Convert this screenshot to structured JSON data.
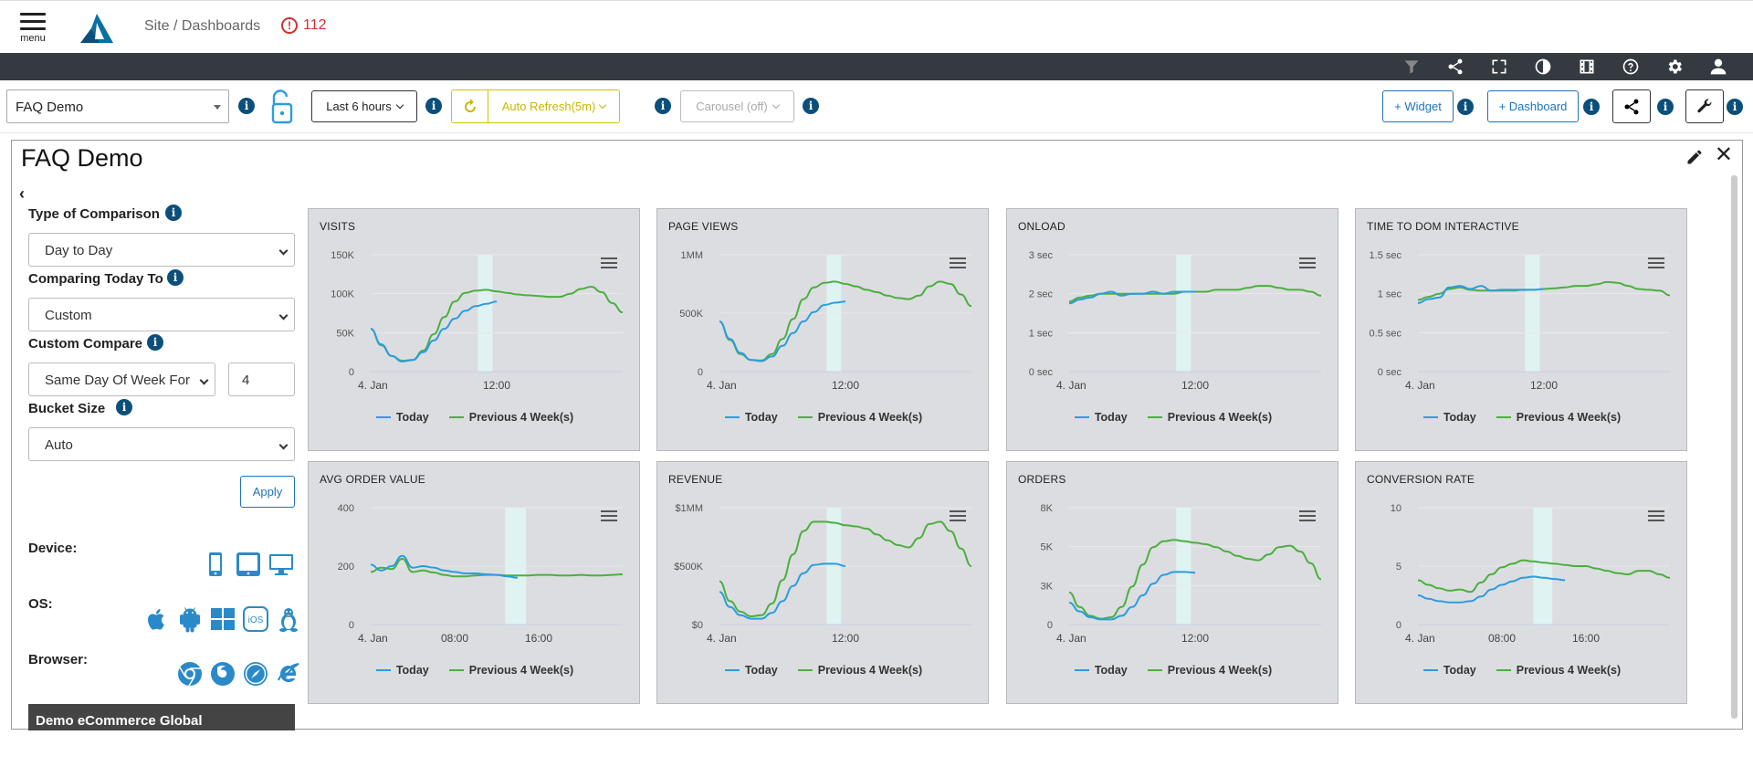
{
  "header": {
    "menu_label": "menu",
    "breadcrumb": "Site / Dashboards",
    "alert_count": "112"
  },
  "toolbar": {
    "dashboard_select": "FAQ Demo",
    "time_range": "Last 6 hours",
    "auto_refresh": "Auto Refresh(5m)",
    "carousel": "Carousel (off)",
    "add_widget": "+ Widget",
    "add_dashboard": "+ Dashboard"
  },
  "panel": {
    "title": "FAQ Demo"
  },
  "sidebar": {
    "type_label": "Type of Comparison",
    "type_value": "Day to Day",
    "comparing_label": "Comparing Today To",
    "comparing_value": "Custom",
    "custom_label": "Custom Compare",
    "custom_value": "Same Day Of Week For",
    "custom_weeks": "4",
    "bucket_label": "Bucket Size",
    "bucket_value": "Auto",
    "apply_label": "Apply",
    "device_label": "Device:",
    "os_label": "OS:",
    "browser_label": "Browser:",
    "footer_text": "Demo eCommerce Global",
    "devices": [
      "phone-icon",
      "tablet-icon",
      "desktop-icon"
    ],
    "os": [
      "apple-icon",
      "android-icon",
      "windows-icon",
      "ios-icon",
      "linux-icon"
    ],
    "browsers": [
      "chrome-icon",
      "firefox-icon",
      "safari-icon",
      "ie-icon"
    ]
  },
  "legend": {
    "today": "Today",
    "previous": "Previous 4 Week(s)"
  },
  "colors": {
    "today": "#2a9de0",
    "previous": "#4caf3f",
    "highlight": "#dff3f3",
    "accent": "#1e73be"
  },
  "chart_data": [
    {
      "type": "line",
      "title": "VISITS",
      "yticks": [
        "150K",
        "100K",
        "50K",
        "0"
      ],
      "ylim": [
        0,
        150000
      ],
      "xticks": [
        {
          "label": "4. Jan",
          "x": 0
        },
        {
          "label": "12:00",
          "x": 12
        }
      ],
      "xlim": [
        0,
        24
      ],
      "band": [
        10.2,
        11.6
      ],
      "series": [
        {
          "name": "Today",
          "x": [
            0,
            1,
            2,
            3,
            4,
            5,
            6,
            7,
            8,
            9,
            10,
            11,
            12
          ],
          "y": [
            55000,
            35000,
            20000,
            13000,
            15000,
            25000,
            40000,
            55000,
            68000,
            78000,
            84000,
            87000,
            90000
          ]
        },
        {
          "name": "Previous 4 Week(s)",
          "x": [
            0,
            1,
            2,
            3,
            4,
            5,
            6,
            7,
            8,
            9,
            10,
            11,
            12,
            13,
            14,
            15,
            16,
            17,
            18,
            19,
            20,
            21,
            22,
            23,
            24
          ],
          "y": [
            55000,
            34000,
            20000,
            14000,
            15000,
            27000,
            48000,
            70000,
            90000,
            101000,
            104000,
            105000,
            103000,
            101000,
            99000,
            98000,
            97000,
            96000,
            96000,
            100000,
            106000,
            109000,
            102000,
            88000,
            76000
          ]
        }
      ]
    },
    {
      "type": "line",
      "title": "PAGE VIEWS",
      "yticks": [
        "1MM",
        "500K",
        "0"
      ],
      "ylim": [
        0,
        1000000
      ],
      "xticks": [
        {
          "label": "4. Jan",
          "x": 0
        },
        {
          "label": "12:00",
          "x": 12
        }
      ],
      "xlim": [
        0,
        24
      ],
      "band": [
        10.2,
        11.6
      ],
      "series": [
        {
          "name": "Today",
          "x": [
            0,
            1,
            2,
            3,
            4,
            5,
            6,
            7,
            8,
            9,
            10,
            11,
            12
          ],
          "y": [
            430000,
            280000,
            160000,
            100000,
            90000,
            130000,
            220000,
            330000,
            430000,
            510000,
            570000,
            590000,
            600000
          ]
        },
        {
          "name": "Previous 4 Week(s)",
          "x": [
            0,
            1,
            2,
            3,
            4,
            5,
            6,
            7,
            8,
            9,
            10,
            11,
            12,
            13,
            14,
            15,
            16,
            17,
            18,
            19,
            20,
            21,
            22,
            23,
            24
          ],
          "y": [
            430000,
            270000,
            150000,
            100000,
            95000,
            150000,
            280000,
            450000,
            620000,
            720000,
            760000,
            770000,
            750000,
            730000,
            700000,
            680000,
            650000,
            630000,
            620000,
            650000,
            730000,
            770000,
            750000,
            660000,
            560000
          ]
        }
      ]
    },
    {
      "type": "line",
      "title": "ONLOAD",
      "yticks": [
        "3 sec",
        "2 sec",
        "1 sec",
        "0 sec"
      ],
      "ylim": [
        0,
        3
      ],
      "xticks": [
        {
          "label": "4. Jan",
          "x": 0
        },
        {
          "label": "12:00",
          "x": 12
        }
      ],
      "xlim": [
        0,
        24
      ],
      "band": [
        10.2,
        11.6
      ],
      "series": [
        {
          "name": "Today",
          "x": [
            0,
            1,
            2,
            3,
            4,
            5,
            6,
            7,
            8,
            9,
            10,
            11,
            12
          ],
          "y": [
            1.75,
            1.85,
            1.9,
            2.0,
            2.05,
            1.95,
            2.0,
            2.0,
            2.05,
            2.0,
            2.05,
            2.05,
            2.05
          ]
        },
        {
          "name": "Previous 4 Week(s)",
          "x": [
            0,
            1,
            2,
            3,
            4,
            5,
            6,
            7,
            8,
            9,
            10,
            11,
            12,
            13,
            14,
            15,
            16,
            17,
            18,
            19,
            20,
            21,
            22,
            23,
            24
          ],
          "y": [
            1.8,
            1.9,
            1.95,
            2.0,
            2.0,
            2.0,
            2.0,
            2.0,
            2.0,
            2.0,
            2.0,
            2.05,
            2.05,
            2.05,
            2.1,
            2.1,
            2.1,
            2.15,
            2.2,
            2.2,
            2.15,
            2.1,
            2.1,
            2.05,
            1.95
          ]
        }
      ]
    },
    {
      "type": "line",
      "title": "TIME TO DOM INTERACTIVE",
      "yticks": [
        "1.5 sec",
        "1 sec",
        "0.5 sec",
        "0 sec"
      ],
      "ylim": [
        0,
        1.5
      ],
      "xticks": [
        {
          "label": "4. Jan",
          "x": 0
        },
        {
          "label": "12:00",
          "x": 12
        }
      ],
      "xlim": [
        0,
        24
      ],
      "band": [
        10.2,
        11.6
      ],
      "series": [
        {
          "name": "Today",
          "x": [
            0,
            1,
            2,
            3,
            4,
            5,
            6,
            7,
            8,
            9,
            10,
            11,
            12
          ],
          "y": [
            0.88,
            0.93,
            0.95,
            1.08,
            1.1,
            1.06,
            1.1,
            1.04,
            1.05,
            1.05,
            1.05,
            1.05,
            1.06
          ]
        },
        {
          "name": "Previous 4 Week(s)",
          "x": [
            0,
            1,
            2,
            3,
            4,
            5,
            6,
            7,
            8,
            9,
            10,
            11,
            12,
            13,
            14,
            15,
            16,
            17,
            18,
            19,
            20,
            21,
            22,
            23,
            24
          ],
          "y": [
            0.92,
            0.96,
            1.0,
            1.06,
            1.08,
            1.05,
            1.04,
            1.04,
            1.04,
            1.04,
            1.05,
            1.05,
            1.06,
            1.07,
            1.08,
            1.1,
            1.1,
            1.12,
            1.15,
            1.14,
            1.1,
            1.06,
            1.05,
            1.04,
            0.98
          ]
        }
      ]
    },
    {
      "type": "line",
      "title": "AVG ORDER VALUE",
      "yticks": [
        "400",
        "200",
        "0"
      ],
      "ylim": [
        0,
        400
      ],
      "xticks": [
        {
          "label": "4. Jan",
          "x": 0
        },
        {
          "label": "08:00",
          "x": 8
        },
        {
          "label": "16:00",
          "x": 16
        }
      ],
      "xlim": [
        0,
        24
      ],
      "band": [
        12.8,
        14.8
      ],
      "series": [
        {
          "name": "Today",
          "x": [
            0,
            1,
            2,
            3,
            4,
            5,
            6,
            7,
            8,
            9,
            10,
            11,
            12,
            13,
            14
          ],
          "y": [
            205,
            185,
            200,
            235,
            195,
            200,
            195,
            185,
            180,
            175,
            175,
            172,
            170,
            165,
            160
          ]
        },
        {
          "name": "Previous 4 Week(s)",
          "x": [
            0,
            1,
            2,
            3,
            4,
            5,
            6,
            7,
            8,
            9,
            10,
            11,
            12,
            13,
            14,
            15,
            16,
            17,
            18,
            19,
            20,
            21,
            22,
            23,
            24
          ],
          "y": [
            180,
            195,
            190,
            225,
            180,
            185,
            178,
            170,
            165,
            165,
            168,
            170,
            170,
            168,
            168,
            168,
            170,
            170,
            168,
            168,
            170,
            168,
            168,
            170,
            172
          ]
        }
      ]
    },
    {
      "type": "line",
      "title": "REVENUE",
      "yticks": [
        "$1MM",
        "$500K",
        "$0"
      ],
      "ylim": [
        0,
        1000000
      ],
      "xticks": [
        {
          "label": "4. Jan",
          "x": 0
        },
        {
          "label": "12:00",
          "x": 12
        }
      ],
      "xlim": [
        0,
        24
      ],
      "band": [
        10.2,
        11.6
      ],
      "series": [
        {
          "name": "Today",
          "x": [
            0,
            1,
            2,
            3,
            4,
            5,
            6,
            7,
            8,
            9,
            10,
            11,
            12
          ],
          "y": [
            280000,
            150000,
            80000,
            50000,
            50000,
            100000,
            200000,
            330000,
            440000,
            510000,
            520000,
            520000,
            500000
          ]
        },
        {
          "name": "Previous 4 Week(s)",
          "x": [
            0,
            1,
            2,
            3,
            4,
            5,
            6,
            7,
            8,
            9,
            10,
            11,
            12,
            13,
            14,
            15,
            16,
            17,
            18,
            19,
            20,
            21,
            22,
            23,
            24
          ],
          "y": [
            370000,
            200000,
            110000,
            70000,
            80000,
            180000,
            380000,
            600000,
            800000,
            880000,
            880000,
            870000,
            850000,
            840000,
            820000,
            770000,
            720000,
            680000,
            660000,
            740000,
            860000,
            880000,
            800000,
            650000,
            500000
          ]
        }
      ]
    },
    {
      "type": "line",
      "title": "ORDERS",
      "yticks": [
        "8K",
        "5K",
        "3K",
        "0"
      ],
      "ylim": [
        0,
        8000
      ],
      "xticks": [
        {
          "label": "4. Jan",
          "x": 0
        },
        {
          "label": "12:00",
          "x": 12
        }
      ],
      "xlim": [
        0,
        24
      ],
      "band": [
        10.2,
        11.6
      ],
      "series": [
        {
          "name": "Today",
          "x": [
            0,
            1,
            2,
            3,
            4,
            5,
            6,
            7,
            8,
            9,
            10,
            11,
            12
          ],
          "y": [
            1500,
            900,
            500,
            350,
            350,
            600,
            1200,
            2000,
            2800,
            3400,
            3600,
            3600,
            3550
          ]
        },
        {
          "name": "Previous 4 Week(s)",
          "x": [
            0,
            1,
            2,
            3,
            4,
            5,
            6,
            7,
            8,
            9,
            10,
            11,
            12,
            13,
            14,
            15,
            16,
            17,
            18,
            19,
            20,
            21,
            22,
            23,
            24
          ],
          "y": [
            2200,
            1200,
            600,
            400,
            500,
            1200,
            2600,
            4100,
            5300,
            5700,
            5800,
            5700,
            5600,
            5500,
            5300,
            5000,
            4700,
            4500,
            4400,
            4800,
            5300,
            5400,
            5000,
            4200,
            3100
          ]
        }
      ]
    },
    {
      "type": "line",
      "title": "CONVERSION RATE",
      "yticks": [
        "10",
        "5",
        "0"
      ],
      "ylim": [
        0,
        10
      ],
      "xticks": [
        {
          "label": "4. Jan",
          "x": 0
        },
        {
          "label": "08:00",
          "x": 8
        },
        {
          "label": "16:00",
          "x": 16
        }
      ],
      "xlim": [
        0,
        24
      ],
      "band": [
        11,
        12.8
      ],
      "series": [
        {
          "name": "Today",
          "x": [
            0,
            1,
            2,
            3,
            4,
            5,
            6,
            7,
            8,
            9,
            10,
            11,
            12,
            13,
            14
          ],
          "y": [
            2.5,
            2.2,
            2.0,
            1.9,
            1.9,
            2.0,
            2.4,
            3.0,
            3.4,
            3.7,
            4.0,
            4.1,
            4.0,
            3.9,
            3.8
          ]
        },
        {
          "name": "Previous 4 Week(s)",
          "x": [
            0,
            1,
            2,
            3,
            4,
            5,
            6,
            7,
            8,
            9,
            10,
            11,
            12,
            13,
            14,
            15,
            16,
            17,
            18,
            19,
            20,
            21,
            22,
            23,
            24
          ],
          "y": [
            3.8,
            3.4,
            3.1,
            2.9,
            3.0,
            2.8,
            3.6,
            4.3,
            4.9,
            5.2,
            5.5,
            5.4,
            5.3,
            5.2,
            5.1,
            5.0,
            5.0,
            4.8,
            4.6,
            4.4,
            4.3,
            4.6,
            4.6,
            4.3,
            4.0
          ]
        }
      ]
    }
  ]
}
